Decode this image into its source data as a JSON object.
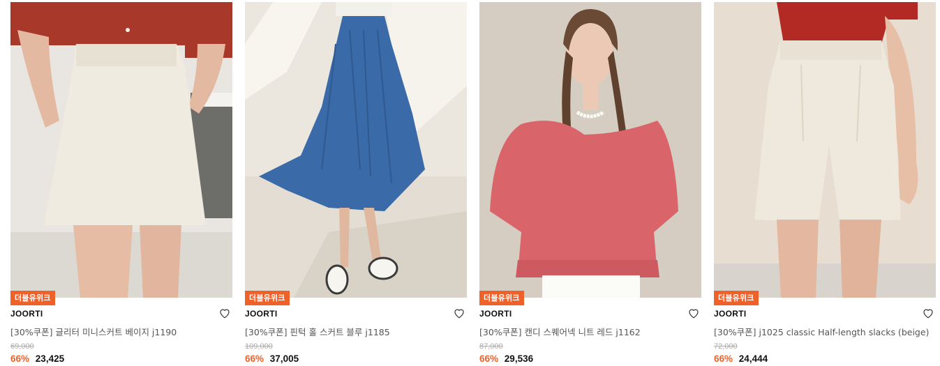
{
  "products": [
    {
      "badge": "더블유위크",
      "brand": "JOORTI",
      "name": "[30%쿠폰] 글리터 미니스커트 베이지 j1190",
      "original_price": "69,000",
      "discount": "66%",
      "price": "23,425",
      "image": "beige-mini-skirt-photo"
    },
    {
      "badge": "더블유위크",
      "brand": "JOORTI",
      "name": "[30%쿠폰] 핀턱 홀 스커트 블루 j1185",
      "original_price": "109,000",
      "discount": "66%",
      "price": "37,005",
      "image": "blue-pintuck-skirt-photo"
    },
    {
      "badge": "더블유위크",
      "brand": "JOORTI",
      "name": "[30%쿠폰] 캔디 스퀘어넥 니트 레드 j1162",
      "original_price": "87,000",
      "discount": "66%",
      "price": "29,536",
      "image": "red-squareneck-knit-photo"
    },
    {
      "badge": "더블유위크",
      "brand": "JOORTI",
      "name": "[30%쿠폰] j1025 classic Half-length slacks (beige)",
      "original_price": "72,000",
      "discount": "66%",
      "price": "24,444",
      "image": "beige-half-slacks-photo"
    }
  ],
  "icons": {
    "wishlist": "heart-outline-icon"
  },
  "colors": {
    "accent": "#f0612a",
    "strike": "#aaaaaa"
  }
}
